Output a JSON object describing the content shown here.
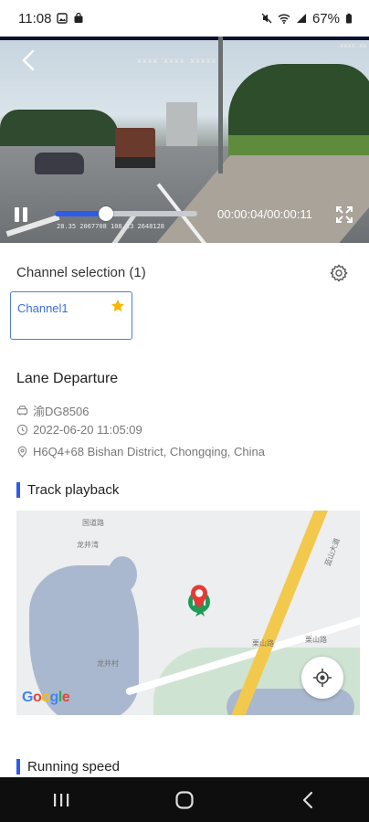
{
  "status_bar": {
    "time": "11:08",
    "battery": "67%"
  },
  "player": {
    "osd_top": "xxxx xxxx xxxxx",
    "osd_top_right": "xxxx xx",
    "osd_bottom": "28.35 2067708 108.13 2648128",
    "current_time": "00:00:04",
    "duration": "00:00:11",
    "time_display": "00:00:04/00:00:11",
    "progress": 0.36
  },
  "channel_selection": {
    "title": "Channel selection",
    "count": "(1)",
    "channels": [
      {
        "name": "Channel1",
        "starred": true
      }
    ]
  },
  "event": {
    "type": "Lane Departure",
    "plate": "渝DG8506",
    "datetime": "2022-06-20 11:05:09",
    "location": "H6Q4+68 Bishan District, Chongqing, China"
  },
  "track_playback": {
    "title": "Track playback",
    "map_labels": [
      "国道路",
      "龙井湾",
      "龙井村",
      "栗山路",
      "栗山路",
      "蓝山大道"
    ],
    "map_brand": "Google"
  },
  "running_speed": {
    "title": "Running speed"
  },
  "colors": {
    "accent": "#2f5bea",
    "star": "#f5b800",
    "marker_red": "#e53935",
    "marker_green": "#1e9a56"
  },
  "icons": [
    "back-arrow-icon",
    "pause-icon",
    "fullscreen-icon",
    "gear-icon",
    "star-icon",
    "car-icon",
    "clock-icon",
    "location-pin-icon",
    "my-location-icon",
    "recents-icon",
    "home-icon",
    "back-icon"
  ]
}
